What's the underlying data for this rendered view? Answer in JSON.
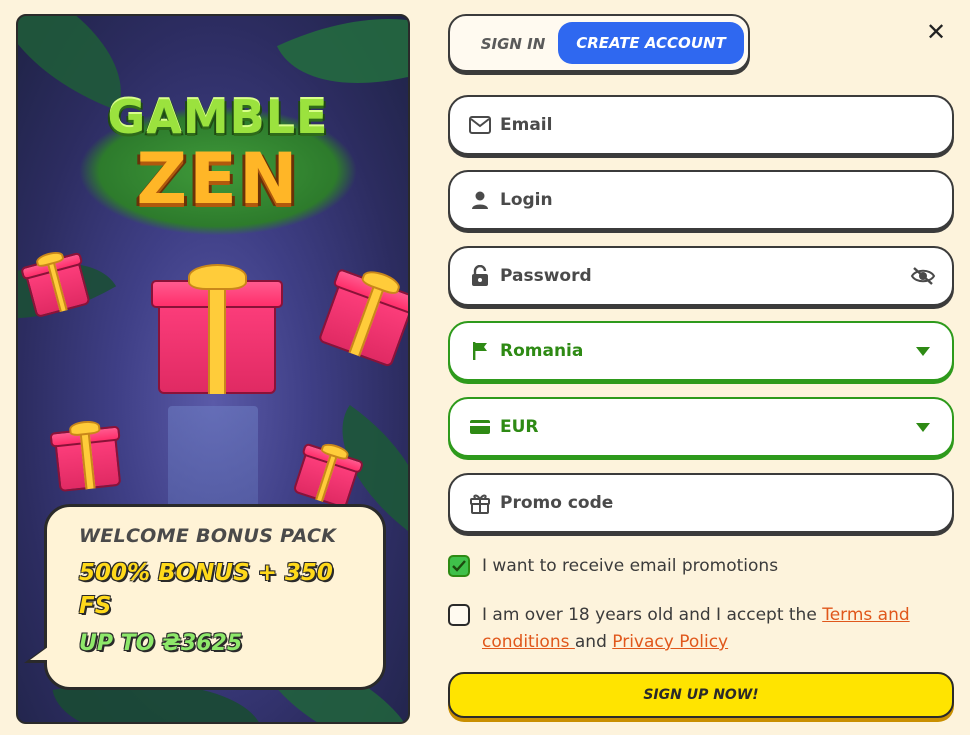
{
  "promo": {
    "logo_line1": "GAMBLE",
    "logo_line2": "ZEN",
    "welcome_title": "WELCOME BONUS PACK",
    "bonus_text": "500% BONUS + 350 FS",
    "up_to_text": "UP TO ₴3625"
  },
  "tabs": {
    "sign_in": "SIGN IN",
    "create_account": "CREATE ACCOUNT",
    "active": "create_account"
  },
  "close_icon": "close-icon",
  "form": {
    "email": {
      "placeholder": "Email",
      "icon": "envelope-icon"
    },
    "login": {
      "placeholder": "Login",
      "icon": "user-icon"
    },
    "password": {
      "placeholder": "Password",
      "icon": "lock-icon",
      "toggle_icon": "eye-off-icon"
    },
    "country": {
      "value": "Romania",
      "icon": "flag-icon"
    },
    "currency": {
      "value": "EUR",
      "icon": "card-icon"
    },
    "promo_code": {
      "placeholder": "Promo code",
      "icon": "gift-icon"
    }
  },
  "checkboxes": {
    "email_promotions": {
      "label": "I want to receive email promotions",
      "checked": true
    },
    "age_terms": {
      "prefix": "I am over 18 years old and I accept the ",
      "terms_link": "Terms and conditions ",
      "middle": "and ",
      "privacy_link": "Privacy Policy",
      "checked": false
    }
  },
  "signup_button": "SIGN UP NOW!",
  "colors": {
    "background": "#fdf3dc",
    "accent_blue": "#2f68f0",
    "accent_green": "#2e9a1c",
    "cta_yellow": "#ffe400",
    "link_orange": "#e0571b"
  }
}
